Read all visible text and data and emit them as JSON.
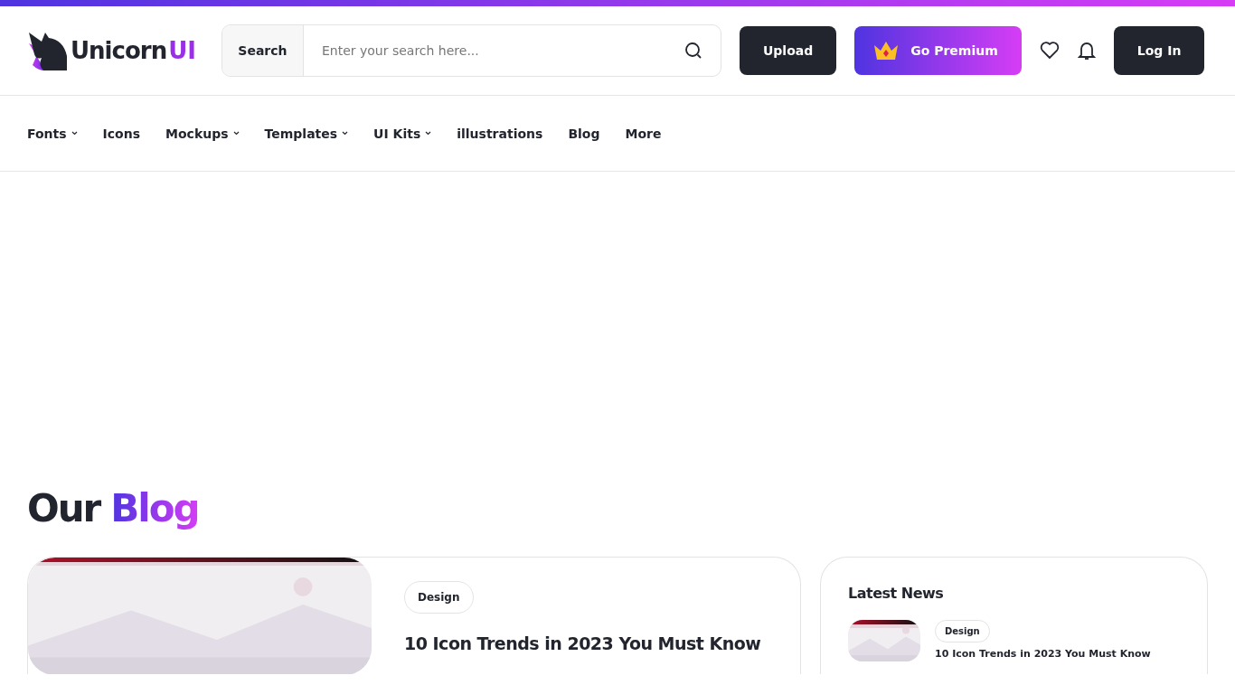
{
  "logo": {
    "text": "Unicorn",
    "accent": "UI"
  },
  "search": {
    "label": "Search",
    "placeholder": "Enter your search here..."
  },
  "actions": {
    "upload": "Upload",
    "premium": "Go Premium",
    "login": "Log In"
  },
  "nav": [
    {
      "label": "Fonts",
      "has_menu": true
    },
    {
      "label": "Icons",
      "has_menu": false
    },
    {
      "label": "Mockups",
      "has_menu": true
    },
    {
      "label": "Templates",
      "has_menu": true
    },
    {
      "label": "UI Kits",
      "has_menu": true
    },
    {
      "label": "illustrations",
      "has_menu": false
    },
    {
      "label": "Blog",
      "has_menu": false
    },
    {
      "label": "More",
      "has_menu": false
    }
  ],
  "blog": {
    "title": "Our",
    "title_accent": "Blog",
    "featured": {
      "kind": "picture",
      "tag": "Design",
      "title": "10 Icon Trends in 2023 You Must Know"
    },
    "latest": {
      "title": "Latest News",
      "items": [
        {
          "kind": "picture",
          "tag": "Design",
          "title": "10 Icon Trends in 2023 You Must Know"
        }
      ]
    }
  }
}
